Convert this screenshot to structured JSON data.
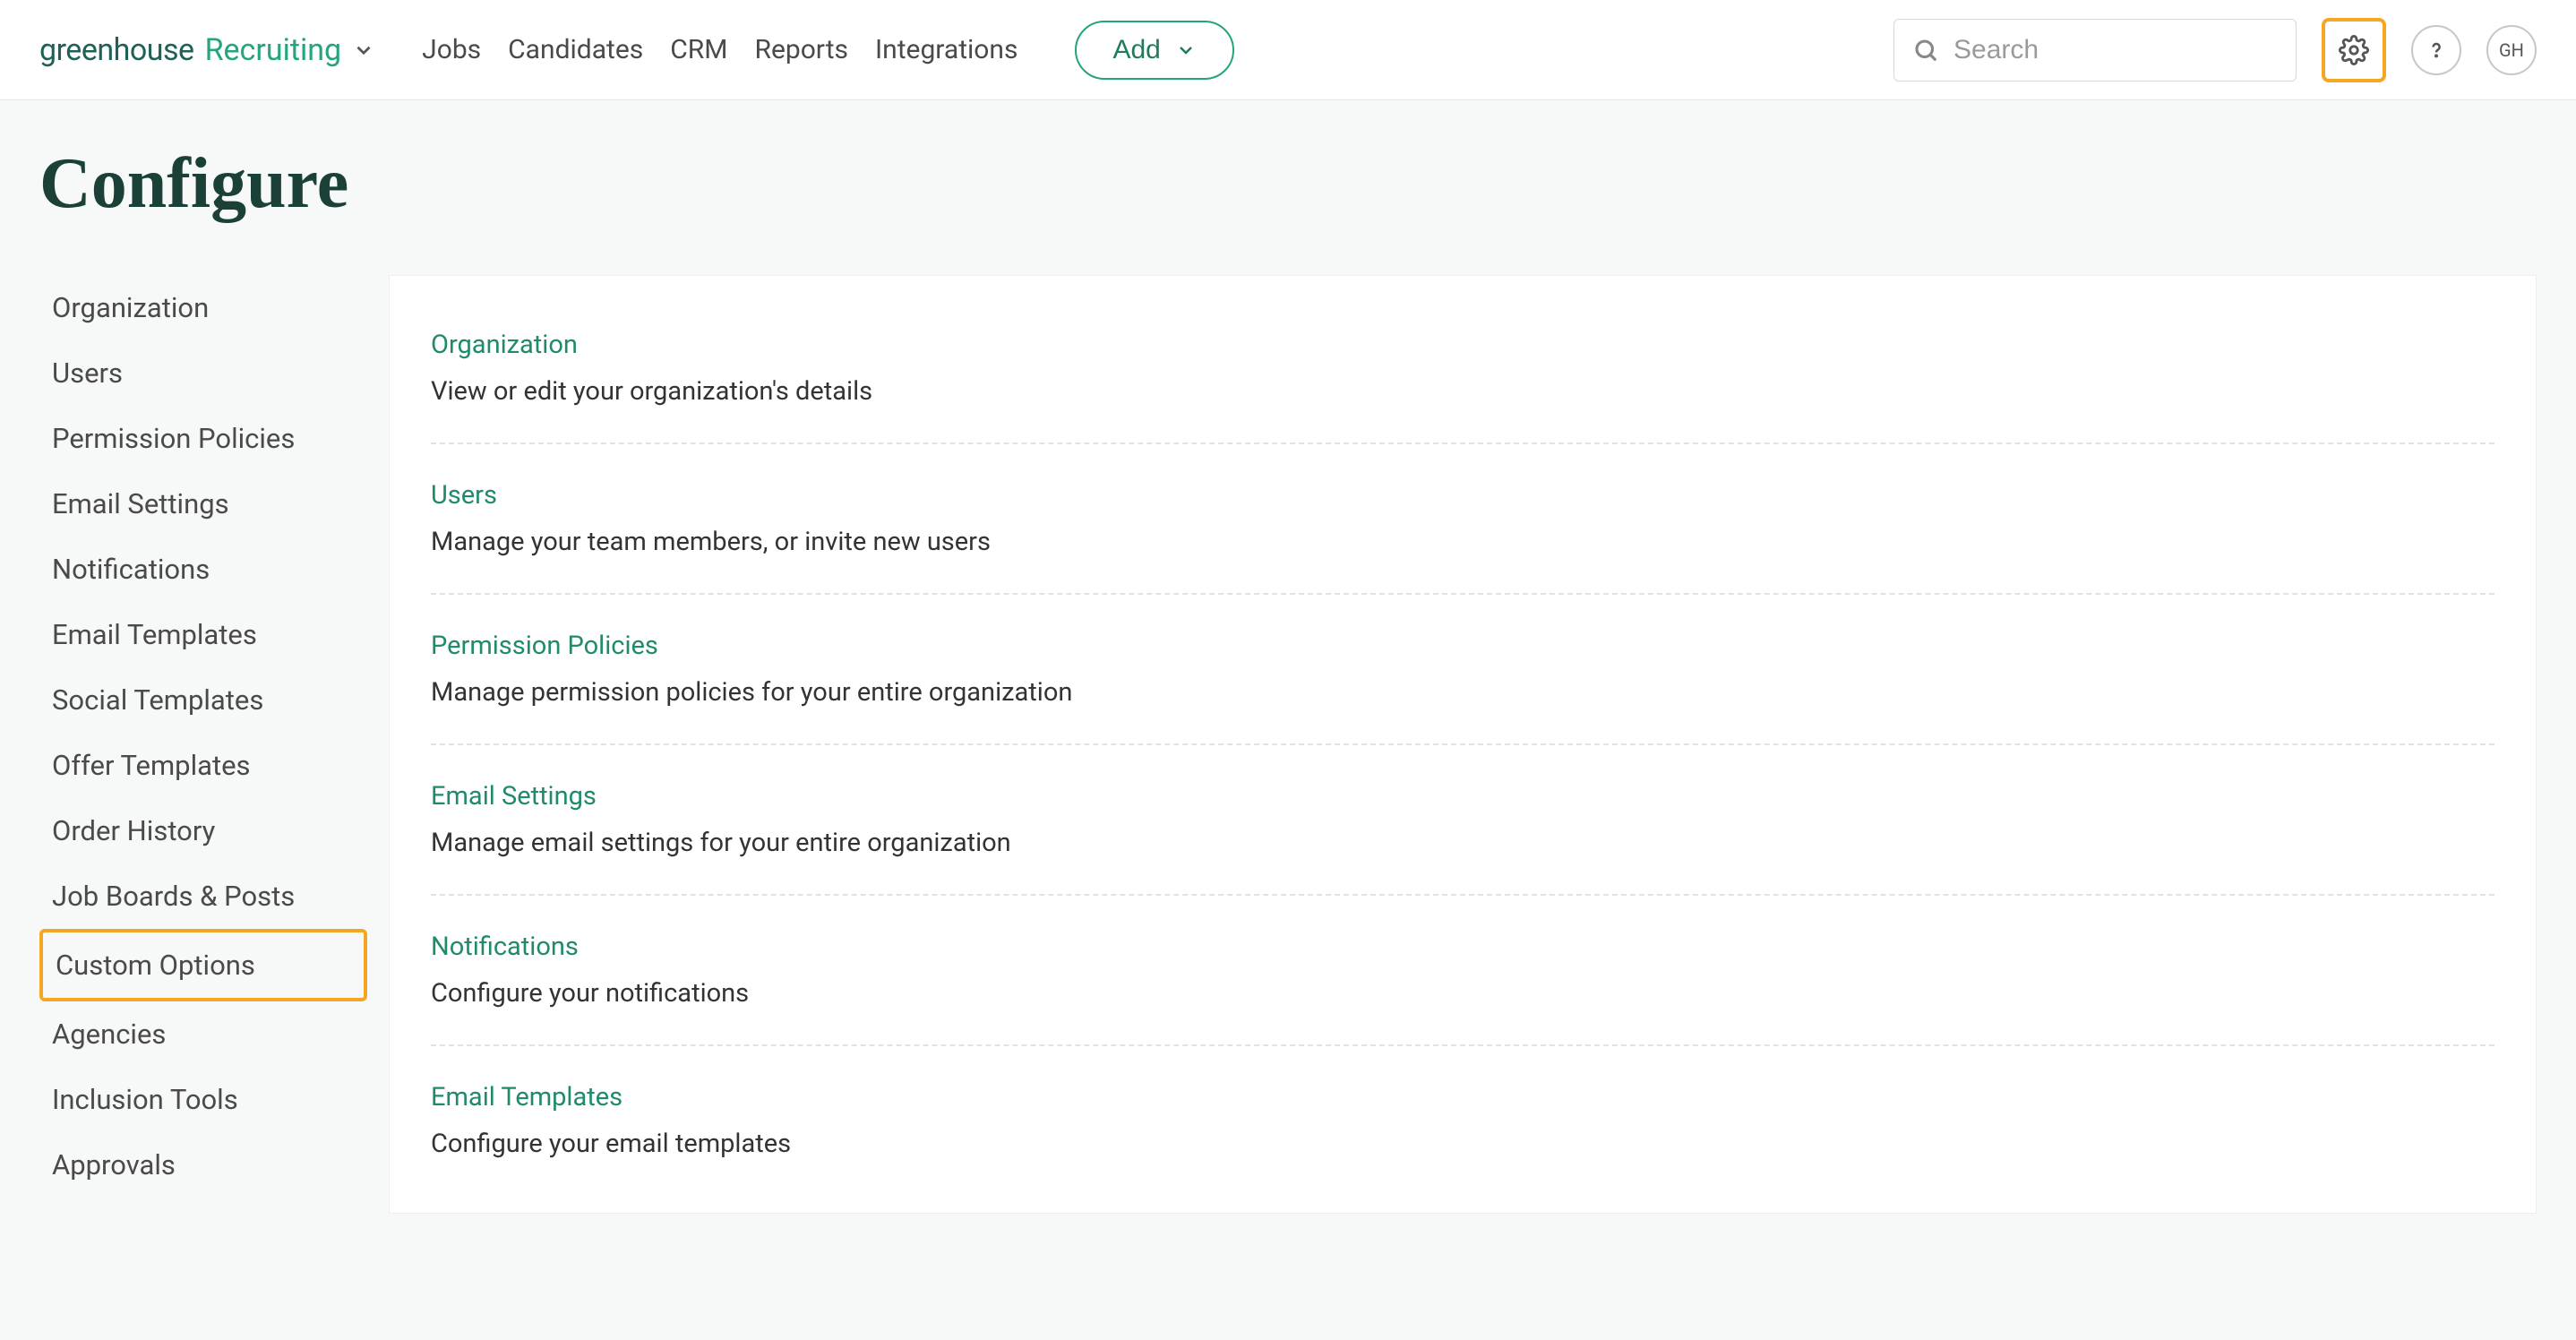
{
  "header": {
    "logo_primary": "greenhouse",
    "logo_secondary": "Recruiting",
    "nav": [
      "Jobs",
      "Candidates",
      "CRM",
      "Reports",
      "Integrations"
    ],
    "add_label": "Add",
    "search_placeholder": "Search",
    "avatar_initials": "GH"
  },
  "page": {
    "title": "Configure"
  },
  "sidebar": {
    "items": [
      {
        "label": "Organization",
        "highlight": false
      },
      {
        "label": "Users",
        "highlight": false
      },
      {
        "label": "Permission Policies",
        "highlight": false
      },
      {
        "label": "Email Settings",
        "highlight": false
      },
      {
        "label": "Notifications",
        "highlight": false
      },
      {
        "label": "Email Templates",
        "highlight": false
      },
      {
        "label": "Social Templates",
        "highlight": false
      },
      {
        "label": "Offer Templates",
        "highlight": false
      },
      {
        "label": "Order History",
        "highlight": false
      },
      {
        "label": "Job Boards & Posts",
        "highlight": false
      },
      {
        "label": "Custom Options",
        "highlight": true
      },
      {
        "label": "Agencies",
        "highlight": false
      },
      {
        "label": "Inclusion Tools",
        "highlight": false
      },
      {
        "label": "Approvals",
        "highlight": false
      }
    ]
  },
  "sections": [
    {
      "title": "Organization",
      "desc": "View or edit your organization's details"
    },
    {
      "title": "Users",
      "desc": "Manage your team members, or invite new users"
    },
    {
      "title": "Permission Policies",
      "desc": "Manage permission policies for your entire organization"
    },
    {
      "title": "Email Settings",
      "desc": "Manage email settings for your entire organization"
    },
    {
      "title": "Notifications",
      "desc": "Configure your notifications"
    },
    {
      "title": "Email Templates",
      "desc": "Configure your email templates"
    }
  ]
}
